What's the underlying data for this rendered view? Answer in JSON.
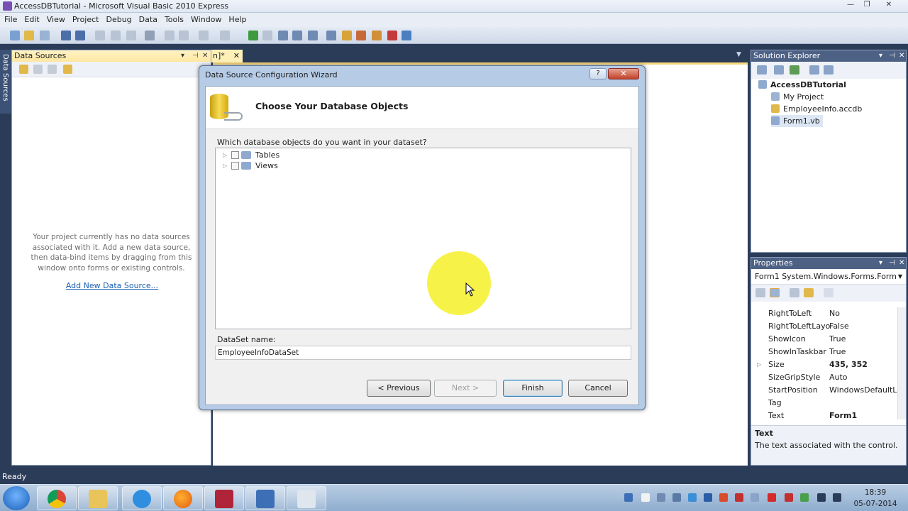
{
  "window": {
    "title": "AccessDBTutorial - Microsoft Visual Basic 2010 Express"
  },
  "menu": [
    "File",
    "Edit",
    "View",
    "Project",
    "Debug",
    "Data",
    "Tools",
    "Window",
    "Help"
  ],
  "side_tab": "Data Sources",
  "data_sources": {
    "title": "Data Sources",
    "message": "Your project currently has no data sources associated with it. Add a new data source, then data-bind items by dragging from this window onto forms or existing controls.",
    "link": "Add New Data Source..."
  },
  "editor": {
    "tab_label": "n]*"
  },
  "solution_explorer": {
    "title": "Solution Explorer",
    "items": [
      {
        "label": "AccessDBTutorial",
        "bold": true
      },
      {
        "label": "My Project"
      },
      {
        "label": "EmployeeInfo.accdb"
      },
      {
        "label": "Form1.vb"
      }
    ]
  },
  "properties": {
    "title": "Properties",
    "object": "Form1 System.Windows.Forms.Form",
    "rows": [
      {
        "name": "RightToLeft",
        "value": "No"
      },
      {
        "name": "RightToLeftLayo",
        "value": "False"
      },
      {
        "name": "ShowIcon",
        "value": "True"
      },
      {
        "name": "ShowInTaskbar",
        "value": "True"
      },
      {
        "name": "Size",
        "value": "435, 352"
      },
      {
        "name": "SizeGripStyle",
        "value": "Auto"
      },
      {
        "name": "StartPosition",
        "value": "WindowsDefaultLc"
      },
      {
        "name": "Tag",
        "value": ""
      },
      {
        "name": "Text",
        "value": "Form1"
      }
    ],
    "desc_title": "Text",
    "desc_text": "The text associated with the control."
  },
  "status": "Ready",
  "clock": {
    "time": "18:39",
    "date": "05-07-2014"
  },
  "wizard": {
    "title": "Data Source Configuration Wizard",
    "heading": "Choose Your Database Objects",
    "question": "Which database objects do you want in your dataset?",
    "objects": [
      "Tables",
      "Views"
    ],
    "dataset_label": "DataSet name:",
    "dataset_value": "EmployeeInfoDataSet",
    "buttons": {
      "previous": "< Previous",
      "next": "Next >",
      "finish": "Finish",
      "cancel": "Cancel"
    }
  },
  "icons": {
    "title_icon": "vb-express-icon",
    "taskbar": [
      "windows-start-icon",
      "chrome-icon",
      "file-explorer-icon",
      "internet-explorer-icon",
      "firefox-icon",
      "access-icon",
      "visual-basic-icon",
      "window-app-icon"
    ]
  },
  "colors": {
    "ide_dark": "#2b3c59",
    "panel_header_active": "#ffe7a2",
    "link": "#1a5fb4",
    "cursor_highlight": "#f6f028"
  }
}
